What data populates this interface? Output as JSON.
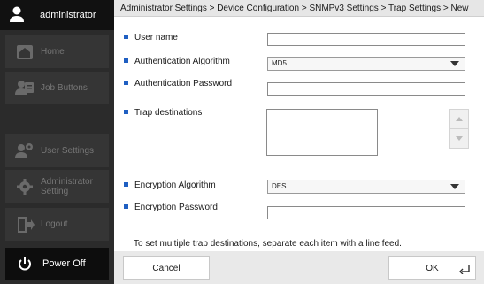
{
  "sidebar": {
    "user": "administrator",
    "items": [
      {
        "label": "Home",
        "icon": "home-icon"
      },
      {
        "label": "Job Buttons",
        "icon": "job-buttons-icon"
      },
      {
        "label": "User Settings",
        "icon": "user-settings-icon"
      },
      {
        "label_line1": "Administrator",
        "label_line2": "Setting",
        "icon": "admin-gear-icon"
      },
      {
        "label": "Logout",
        "icon": "logout-icon"
      }
    ],
    "power": "Power Off"
  },
  "breadcrumb": "Administrator Settings > Device Configuration > SNMPv3 Settings > Trap Settings > New",
  "form": {
    "user_name": {
      "label": "User name",
      "value": ""
    },
    "auth_algorithm": {
      "label": "Authentication Algorithm",
      "value": "MD5"
    },
    "auth_password": {
      "label": "Authentication Password",
      "value": ""
    },
    "trap_destinations": {
      "label": "Trap destinations",
      "value": ""
    },
    "enc_algorithm": {
      "label": "Encryption Algorithm",
      "value": "DES"
    },
    "enc_password": {
      "label": "Encryption Password",
      "value": ""
    }
  },
  "note": "To set multiple trap destinations, separate each item with a line feed.",
  "footer": {
    "cancel": "Cancel",
    "ok": "OK"
  },
  "colors": {
    "accent_square": "#1f5fc2",
    "sidebar": "#2b2b2b",
    "sidebar_header": "#111111"
  }
}
